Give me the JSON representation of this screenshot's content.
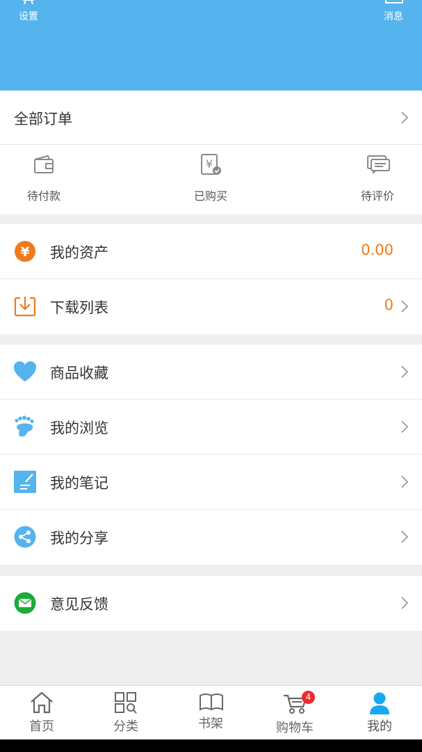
{
  "header": {
    "settings_label": "设置",
    "messages_label": "消息",
    "bg_color": "#55b3ee"
  },
  "orders": {
    "title": "全部订单",
    "items": [
      {
        "label": "待付款",
        "icon": "wallet-icon"
      },
      {
        "label": "已购买",
        "icon": "purchased-receipt-icon"
      },
      {
        "label": "待评价",
        "icon": "comment-icon"
      }
    ]
  },
  "assets": {
    "my_assets_label": "我的资产",
    "my_assets_value": "0.00",
    "downloads_label": "下载列表",
    "downloads_value": "0",
    "accent_color": "#f07a1a"
  },
  "collect": {
    "items": [
      {
        "label": "商品收藏",
        "icon": "heart-icon"
      },
      {
        "label": "我的浏览",
        "icon": "footprint-icon"
      },
      {
        "label": "我的笔记",
        "icon": "note-icon"
      },
      {
        "label": "我的分享",
        "icon": "share-icon"
      }
    ]
  },
  "feedback": {
    "label": "意见反馈",
    "icon": "mail-icon"
  },
  "tabbar": {
    "tabs": [
      {
        "label": "首页",
        "icon": "home-icon"
      },
      {
        "label": "分类",
        "icon": "category-icon"
      },
      {
        "label": "书架",
        "icon": "bookshelf-icon"
      },
      {
        "label": "购物车",
        "icon": "cart-icon",
        "badge": "4"
      },
      {
        "label": "我的",
        "icon": "user-icon",
        "active": true
      }
    ]
  }
}
